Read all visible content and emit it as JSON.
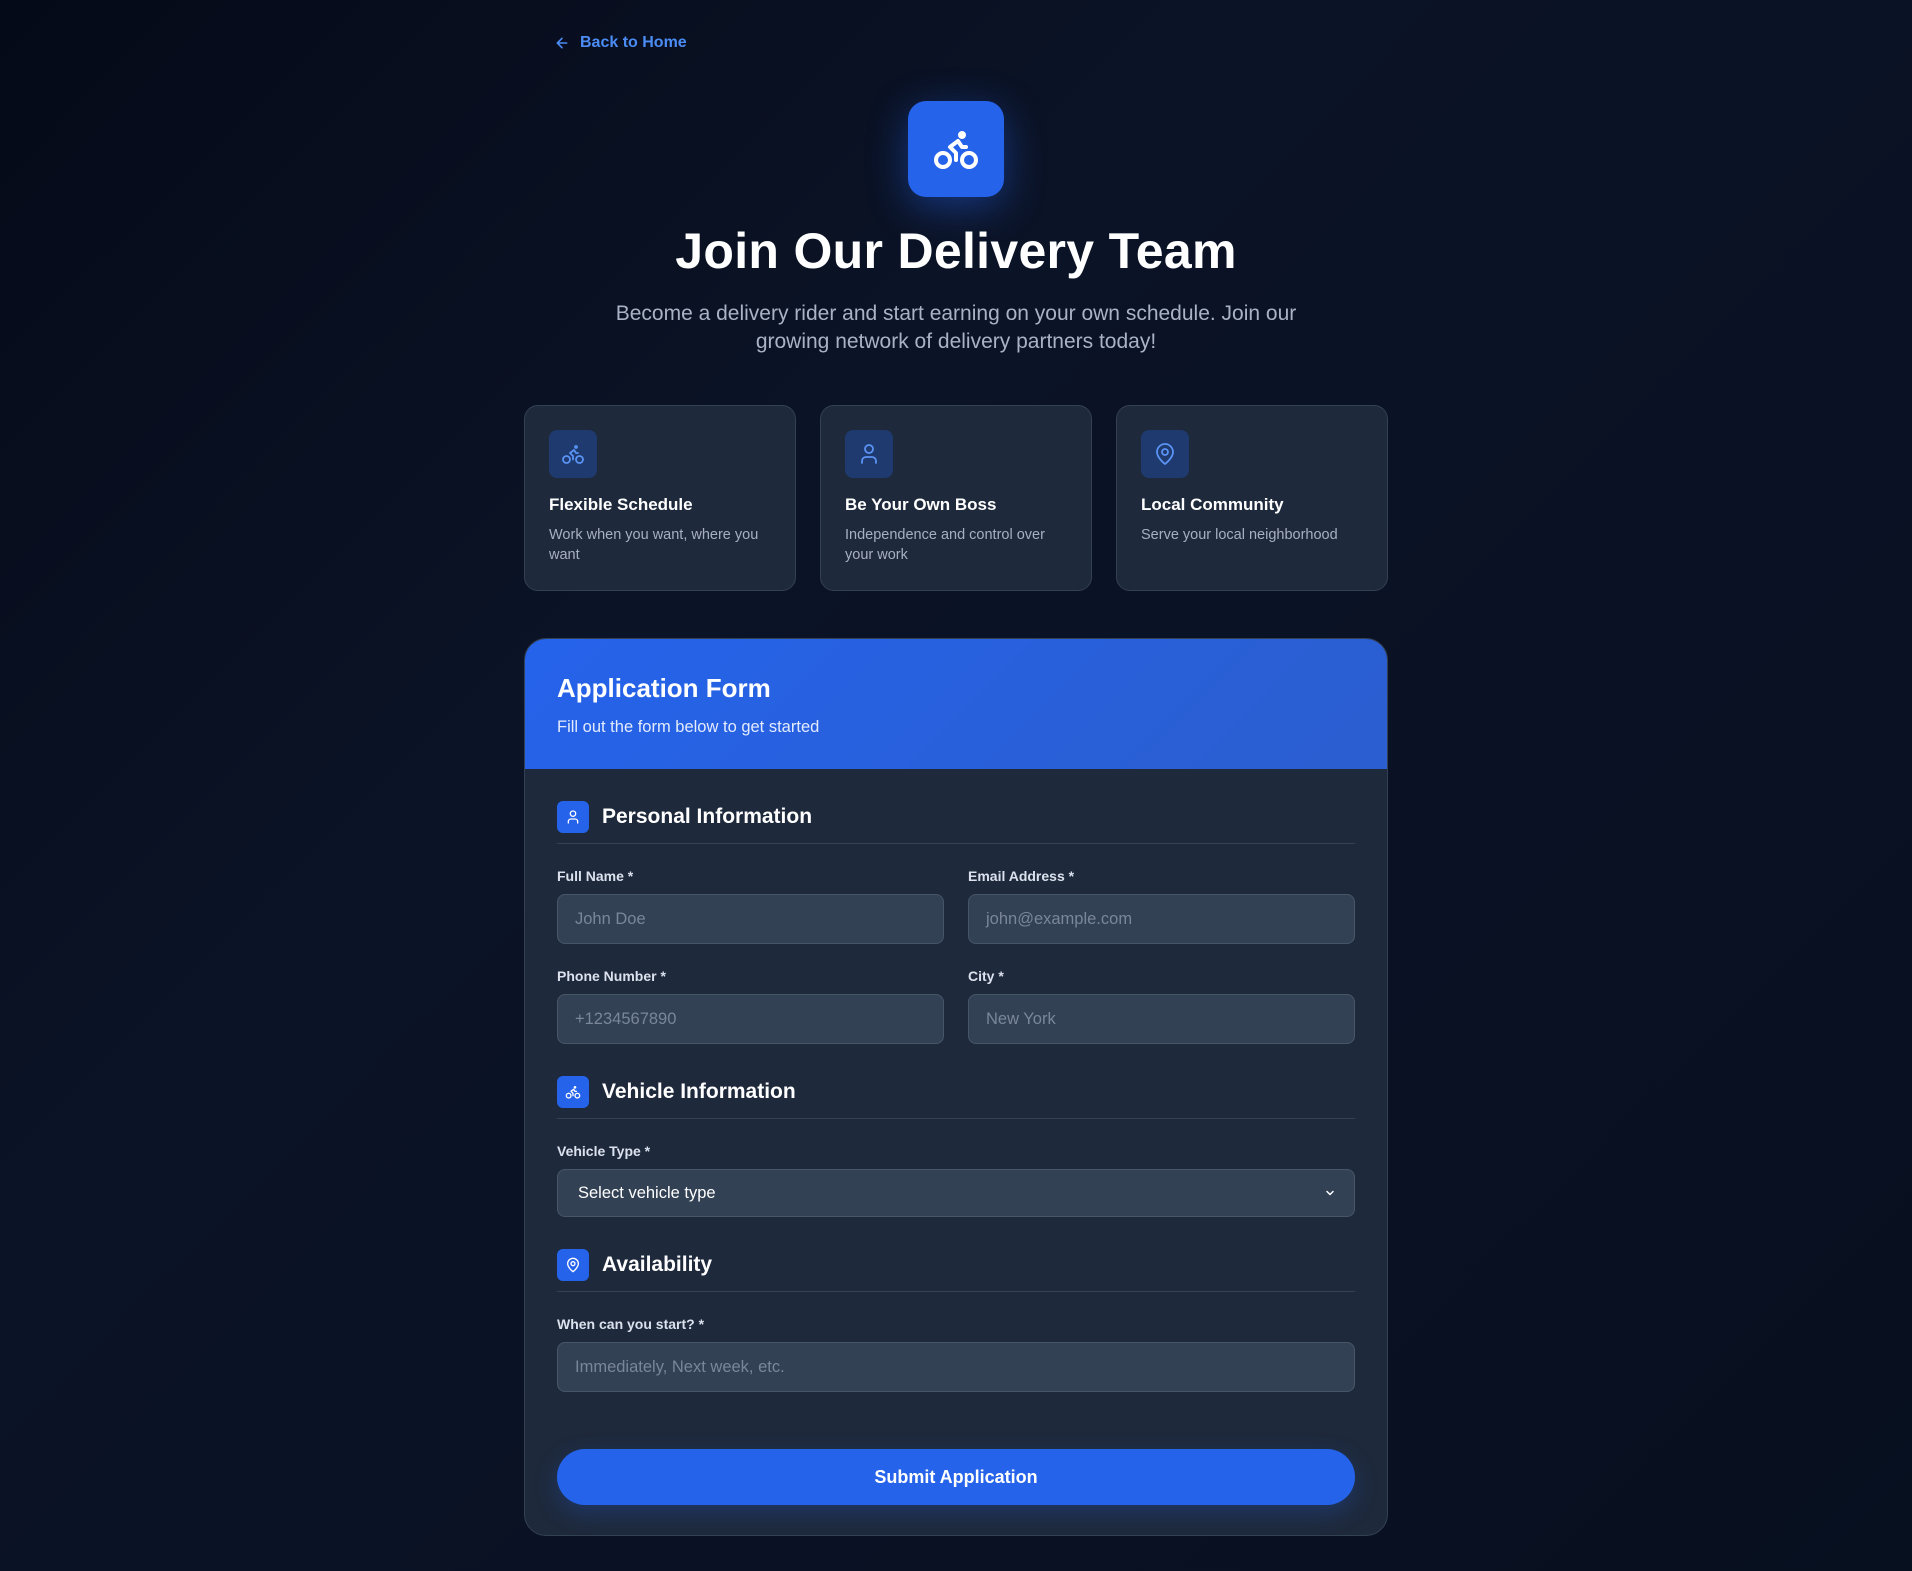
{
  "nav": {
    "back_label": "Back to Home"
  },
  "hero": {
    "icon": "bike-icon",
    "title": "Join Our Delivery Team",
    "subtitle": "Become a delivery rider and start earning on your own schedule. Join our growing network of delivery partners today!"
  },
  "features": [
    {
      "icon": "bike-icon",
      "title": "Flexible Schedule",
      "desc": "Work when you want, where you want"
    },
    {
      "icon": "user-icon",
      "title": "Be Your Own Boss",
      "desc": "Independence and control over your work"
    },
    {
      "icon": "map-pin-icon",
      "title": "Local Community",
      "desc": "Serve your local neighborhood"
    }
  ],
  "form": {
    "title": "Application Form",
    "subtitle": "Fill out the form below to get started",
    "personal": {
      "title": "Personal Information",
      "icon": "user-icon",
      "full_name": {
        "label": "Full Name *",
        "placeholder": "John Doe",
        "value": ""
      },
      "email": {
        "label": "Email Address *",
        "placeholder": "john@example.com",
        "value": ""
      },
      "phone": {
        "label": "Phone Number *",
        "placeholder": "+1234567890",
        "value": ""
      },
      "city": {
        "label": "City *",
        "placeholder": "New York",
        "value": ""
      }
    },
    "vehicle": {
      "title": "Vehicle Information",
      "icon": "bike-icon",
      "type": {
        "label": "Vehicle Type *",
        "selected": "Select vehicle type"
      }
    },
    "availability": {
      "title": "Availability",
      "icon": "map-pin-icon",
      "start": {
        "label": "When can you start? *",
        "placeholder": "Immediately, Next week, etc.",
        "value": ""
      }
    },
    "submit_label": "Submit Application"
  },
  "colors": {
    "accent": "#2563eb",
    "link": "#4b8cf5",
    "card_bg": "#1e293b",
    "input_bg": "#334155"
  }
}
